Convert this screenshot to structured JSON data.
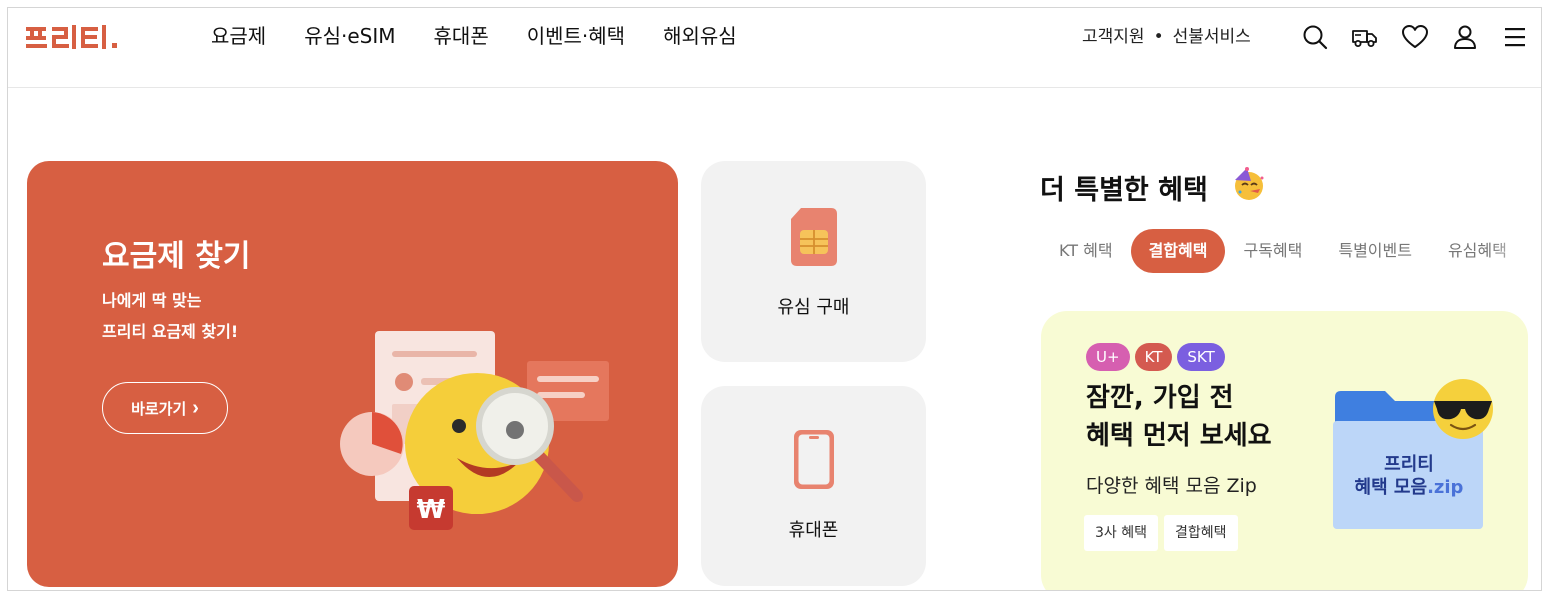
{
  "brand": {
    "logo_text": "프리티.",
    "accent": "#d75f42"
  },
  "nav": {
    "items": [
      {
        "label": "요금제"
      },
      {
        "label": "유심·eSIM"
      },
      {
        "label": "휴대폰"
      },
      {
        "label": "이벤트·혜택"
      },
      {
        "label": "해외유심"
      }
    ]
  },
  "util": {
    "support": "고객지원",
    "separator": "•",
    "prepaid": "선불서비스"
  },
  "header_icons": [
    "search-icon",
    "delivery-truck-icon",
    "heart-icon",
    "user-icon",
    "menu-icon"
  ],
  "find_card": {
    "title": "요금제 찾기",
    "subtitle_line1": "나에게 딱 맞는",
    "subtitle_line2": "프리티 요금제 찾기!",
    "button_label": "바로가기",
    "button_chevron": "›",
    "won_symbol": "₩",
    "bg_color": "#d75f42"
  },
  "quick_cards": [
    {
      "label": "유심 구매",
      "icon": "sim-card-icon"
    },
    {
      "label": "휴대폰",
      "icon": "smartphone-icon"
    }
  ],
  "benefits": {
    "title": "더 특별한 혜택",
    "title_emoji": "party-face-icon",
    "tabs": [
      {
        "label": "KT 혜택",
        "active": false
      },
      {
        "label": "결합혜택",
        "active": true
      },
      {
        "label": "구독혜택",
        "active": false
      },
      {
        "label": "특별이벤트",
        "active": false
      },
      {
        "label": "유심혜택",
        "active": false
      }
    ],
    "promo": {
      "badges": [
        {
          "label": "U+",
          "color": "#d65fb0"
        },
        {
          "label": "KT",
          "color": "#d45a50"
        },
        {
          "label": "SKT",
          "color": "#7b5fe0"
        }
      ],
      "title_line1": "잠깐, 가입 전",
      "title_line2": "혜택 먼저 보세요",
      "subtitle": "다양한 혜택 모음 Zip",
      "chips": [
        "3사 혜택",
        "결합혜택"
      ],
      "art_line1": "프리티",
      "art_line2_a": "혜택 모음",
      "art_line2_b": ".zip",
      "bg_color": "#f8fbd4"
    }
  }
}
